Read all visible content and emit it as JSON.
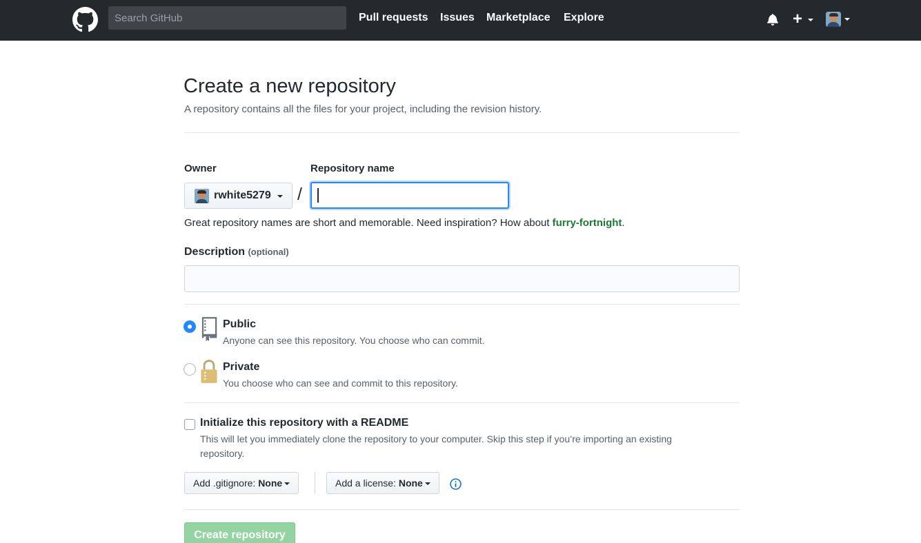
{
  "header": {
    "search_placeholder": "Search GitHub",
    "nav": [
      {
        "label": "Pull requests"
      },
      {
        "label": "Issues"
      },
      {
        "label": "Marketplace"
      },
      {
        "label": "Explore"
      }
    ],
    "plus_label": "+"
  },
  "page": {
    "title": "Create a new repository",
    "subtitle": "A repository contains all the files for your project, including the revision history."
  },
  "form": {
    "owner_label": "Owner",
    "owner_name": "rwhite5279",
    "slash": "/",
    "repo_name_label": "Repository name",
    "repo_name_value": "",
    "hint_prefix": "Great repository names are short and memorable. Need inspiration? How about ",
    "hint_suggestion": "furry-fortnight",
    "hint_suffix": ".",
    "description_label": "Description",
    "description_optional": "(optional)",
    "description_value": "",
    "visibility": {
      "selected": "public",
      "public_title": "Public",
      "public_desc": "Anyone can see this repository. You choose who can commit.",
      "private_title": "Private",
      "private_desc": "You choose who can see and commit to this repository."
    },
    "init_readme": {
      "checked": false,
      "title": "Initialize this repository with a README",
      "desc": "This will let you immediately clone the repository to your computer. Skip this step if you’re importing an existing repository."
    },
    "gitignore_prefix": "Add .gitignore:",
    "gitignore_value": "None",
    "license_prefix": "Add a license:",
    "license_value": "None",
    "submit_label": "Create repository"
  },
  "colors": {
    "header_bg": "#24292e",
    "accent_blue": "#2188ff",
    "suggestion_green": "#1e7a32",
    "submit_disabled": "#94d3a2"
  },
  "icons": [
    "github-logo-icon",
    "bell-icon",
    "plus-icon",
    "avatar",
    "repo-book-icon",
    "lock-icon",
    "info-icon"
  ]
}
